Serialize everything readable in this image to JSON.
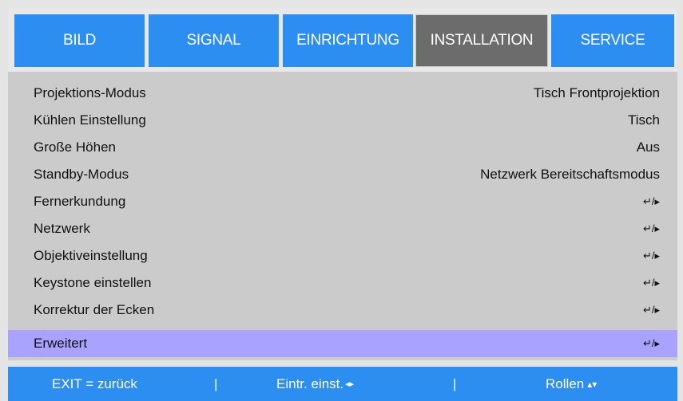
{
  "tabs": [
    {
      "label": "BILD",
      "active": false
    },
    {
      "label": "SIGNAL",
      "active": false
    },
    {
      "label": "EINRICHTUNG",
      "active": false
    },
    {
      "label": "INSTALLATION",
      "active": true
    },
    {
      "label": "SERVICE",
      "active": false
    }
  ],
  "menu": {
    "items": [
      {
        "label": "Projektions-Modus",
        "value": "Tisch Frontprojektion"
      },
      {
        "label": "Kühlen Einstellung",
        "value": "Tisch"
      },
      {
        "label": "Große Höhen",
        "value": "Aus"
      },
      {
        "label": "Standby-Modus",
        "value": "Netzwerk Bereitschaftsmodus"
      },
      {
        "label": "Fernerkundung",
        "value": "↵/▸"
      },
      {
        "label": "Netzwerk",
        "value": "↵/▸"
      },
      {
        "label": "Objektiveinstellung",
        "value": "↵/▸"
      },
      {
        "label": "Keystone einstellen",
        "value": "↵/▸"
      },
      {
        "label": "Korrektur der Ecken",
        "value": "↵/▸"
      },
      {
        "label": "Erweitert",
        "value": "↵/▸",
        "selected": true
      }
    ]
  },
  "footer": {
    "exit": "EXIT = zurück",
    "sep1": "|",
    "enter": "Eintr. einst.",
    "enter_arrows": "◂▸",
    "sep2": "|",
    "scroll": "Rollen",
    "scroll_arrows": "▴▾"
  },
  "colors": {
    "tab_blue": "#2c8ef0",
    "tab_active": "#6c6c6c",
    "panel": "#cbcbcb",
    "selected_row": "#a9a2ff"
  }
}
